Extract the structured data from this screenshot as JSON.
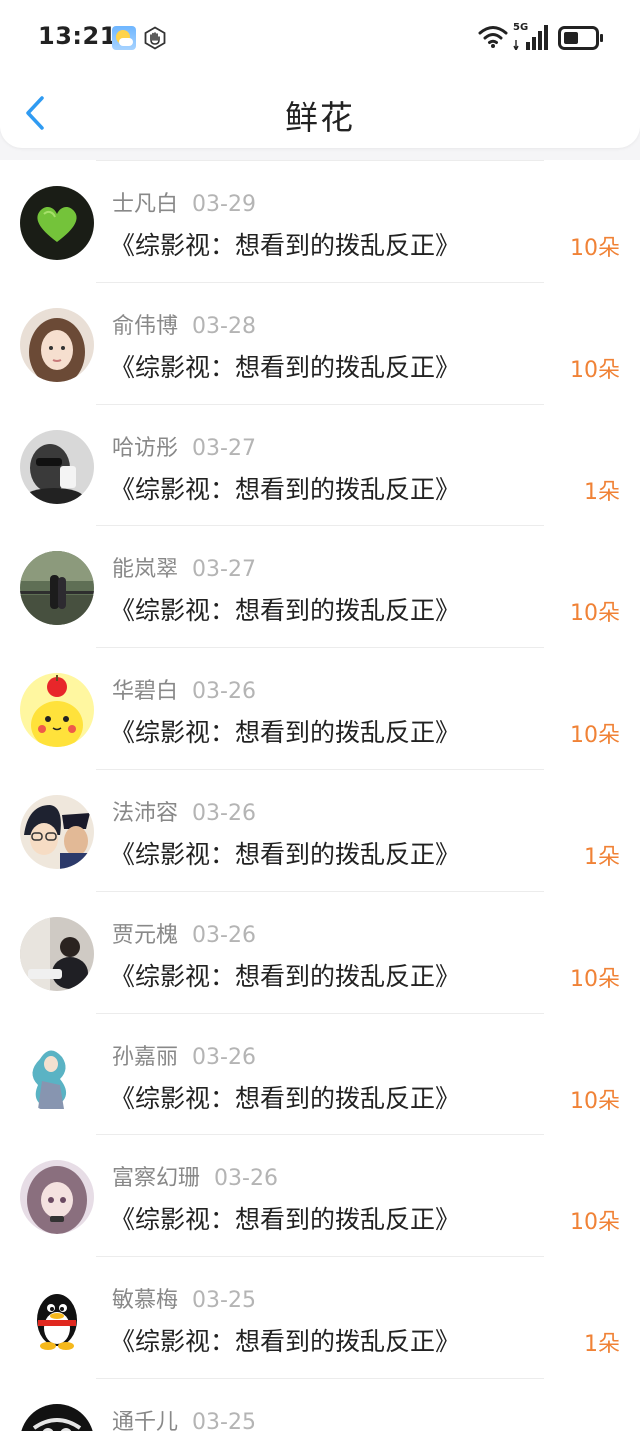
{
  "status": {
    "time": "13:21",
    "network": "5G"
  },
  "nav": {
    "title": "鲜花"
  },
  "colors": {
    "accent": "#2f9bf2",
    "amount": "#f08236",
    "name": "#888888",
    "date": "#b4b4b4"
  },
  "items": [
    {
      "name": "士凡白",
      "date": "03-29",
      "book": "《综影视：想看到的拨乱反正》",
      "amount": "10朵",
      "avatar": "green-heart"
    },
    {
      "name": "俞伟博",
      "date": "03-28",
      "book": "《综影视：想看到的拨乱反正》",
      "amount": "10朵",
      "avatar": "girl-portrait"
    },
    {
      "name": "哈访彤",
      "date": "03-27",
      "book": "《综影视：想看到的拨乱反正》",
      "amount": "1朵",
      "avatar": "bw-sunglasses"
    },
    {
      "name": "能岚翠",
      "date": "03-27",
      "book": "《综影视：想看到的拨乱反正》",
      "amount": "10朵",
      "avatar": "couple-bridge"
    },
    {
      "name": "华碧白",
      "date": "03-26",
      "book": "《综影视：想看到的拨乱反正》",
      "amount": "10朵",
      "avatar": "pikachu-apple"
    },
    {
      "name": "法沛容",
      "date": "03-26",
      "book": "《综影视：想看到的拨乱反正》",
      "amount": "1朵",
      "avatar": "anime-detective"
    },
    {
      "name": "贾元槐",
      "date": "03-26",
      "book": "《综影视：想看到的拨乱反正》",
      "amount": "10朵",
      "avatar": "man-desk"
    },
    {
      "name": "孙嘉丽",
      "date": "03-26",
      "book": "《综影视：想看到的拨乱反正》",
      "amount": "10朵",
      "avatar": "anime-blue-hair"
    },
    {
      "name": "富察幻珊",
      "date": "03-26",
      "book": "《综影视：想看到的拨乱反正》",
      "amount": "10朵",
      "avatar": "anime-girl"
    },
    {
      "name": "敏慕梅",
      "date": "03-25",
      "book": "《综影视：想看到的拨乱反正》",
      "amount": "1朵",
      "avatar": "qq-penguin"
    },
    {
      "name": "通千儿",
      "date": "03-25",
      "book": "",
      "amount": "",
      "avatar": "dark-partial"
    }
  ]
}
